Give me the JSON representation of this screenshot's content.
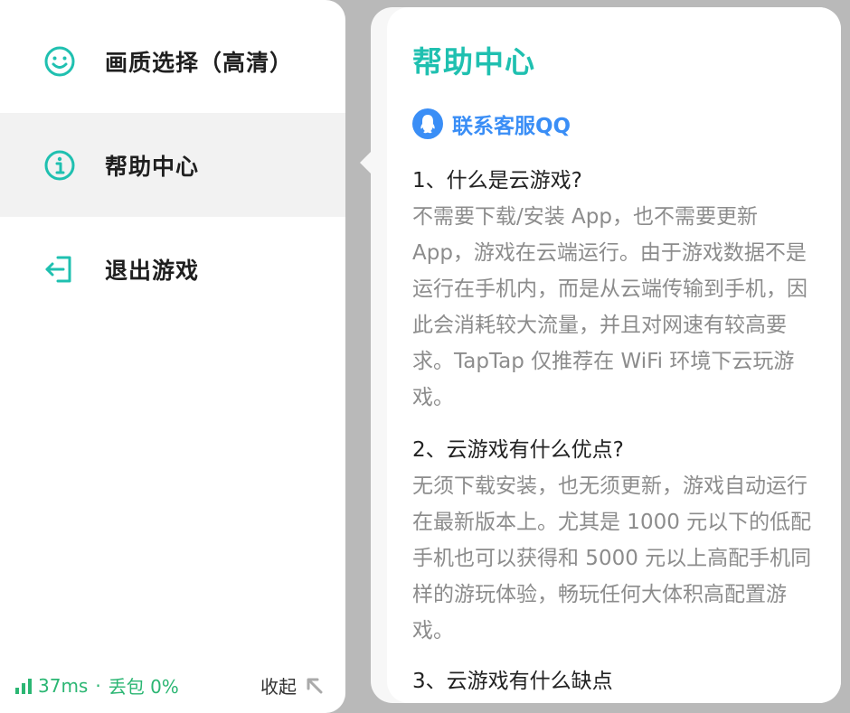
{
  "menu": {
    "items": [
      {
        "label": "画质选择（高清）",
        "icon": "smiley-face-icon"
      },
      {
        "label": "帮助中心",
        "icon": "info-icon"
      },
      {
        "label": "退出游戏",
        "icon": "exit-icon"
      }
    ],
    "active_index": 1
  },
  "status": {
    "latency": "37ms",
    "separator": "·",
    "packet_loss": "丢包 0%",
    "collapse_label": "收起"
  },
  "help": {
    "title": "帮助中心",
    "qq_link_label": "联系客服QQ",
    "faqs": [
      {
        "question": "1、什么是云游戏?",
        "answer": "不需要下载/安装 App，也不需要更新 App，游戏在云端运行。由于游戏数据不是运行在手机内，而是从云端传输到手机，因此会消耗较大流量，并且对网速有较高要求。TapTap 仅推荐在 WiFi 环境下云玩游戏。"
      },
      {
        "question": "2、云游戏有什么优点?",
        "answer": "无须下载安装，也无须更新，游戏自动运行在最新版本上。尤其是 1000 元以下的低配手机也可以获得和 5000 元以上高配手机同样的游玩体验，畅玩任何大体积高配置游戏。"
      },
      {
        "question": "3、云游戏有什么缺点",
        "answer": ""
      }
    ]
  },
  "colors": {
    "accent_teal": "#1fc0b0",
    "status_green": "#2bb673",
    "link_blue": "#3a8ef6",
    "answer_gray": "#8c8c8c"
  }
}
